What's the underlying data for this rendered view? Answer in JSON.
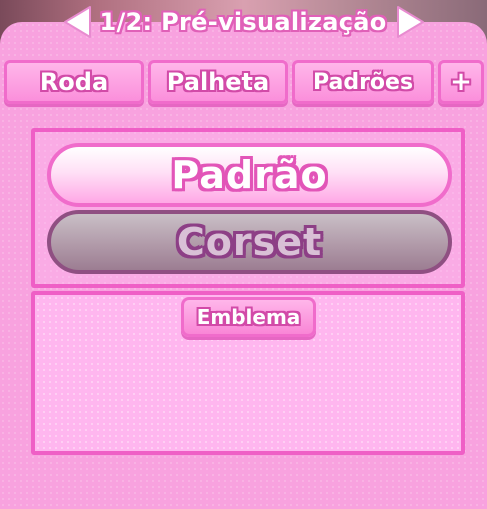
{
  "header": {
    "title": "1/2: Pré-visualização",
    "prev_icon": "triangle-left-icon",
    "next_icon": "triangle-right-icon"
  },
  "tabs": [
    {
      "label": "Roda"
    },
    {
      "label": "Palheta"
    },
    {
      "label": "Padrões"
    },
    {
      "label": "+",
      "icon": "plus-icon"
    }
  ],
  "options": {
    "items": [
      {
        "label": "Padrão",
        "state": "selected"
      },
      {
        "label": "Corset",
        "state": "disabled"
      }
    ]
  },
  "emblem": {
    "label": "Emblema"
  },
  "colors": {
    "panel_bg": "#f8a2df",
    "accent_border": "#ef5fc6",
    "text_outline": "#e255b8",
    "disabled_fill": "#b19aa9"
  }
}
